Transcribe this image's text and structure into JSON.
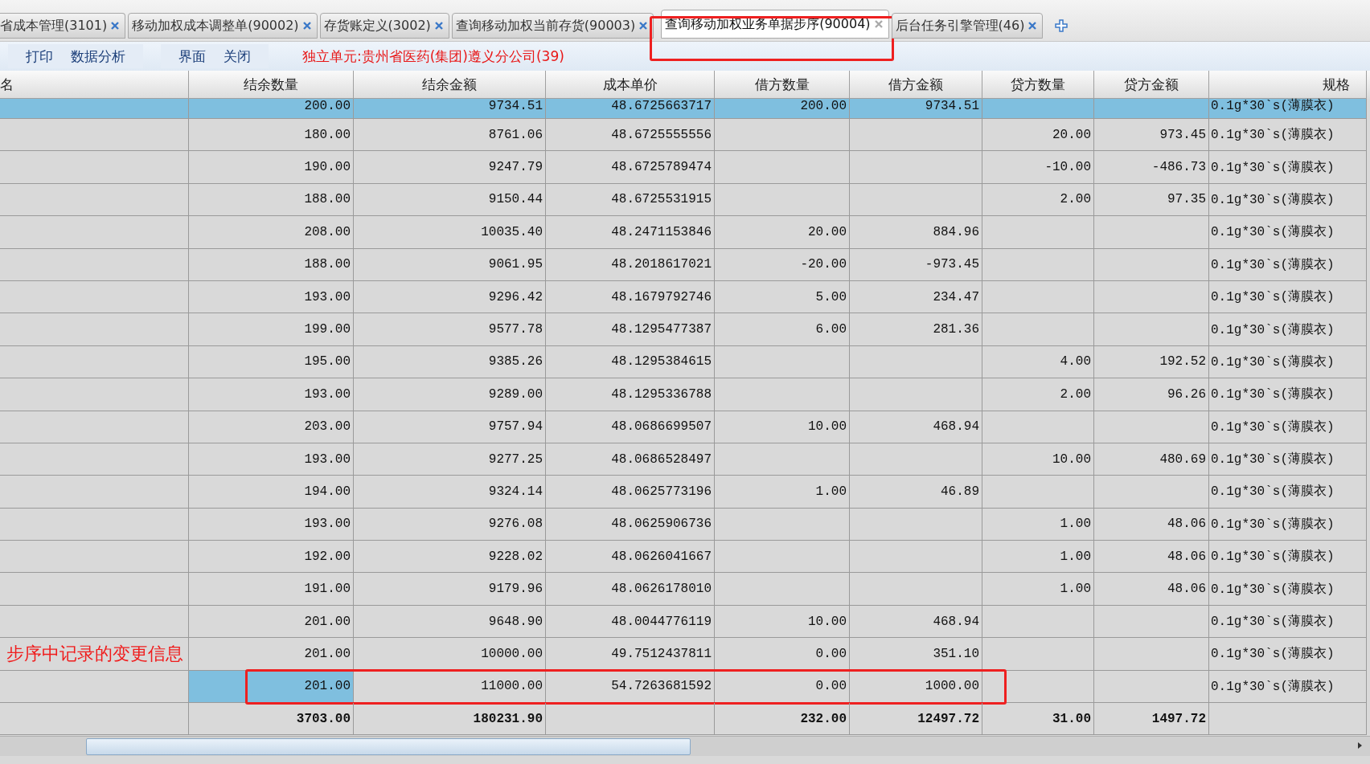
{
  "tabs": [
    {
      "label": "省成本管理(3101)",
      "selected": false,
      "highlighted": false
    },
    {
      "label": "移动加权成本调整单(90002)",
      "selected": false,
      "highlighted": false
    },
    {
      "label": "存货账定义(3002)",
      "selected": false,
      "highlighted": false
    },
    {
      "label": "查询移动加权当前存货(90003)",
      "selected": false,
      "highlighted": false
    },
    {
      "label": "查询移动加权业务单据步序(90004)",
      "selected": true,
      "highlighted": true
    },
    {
      "label": "后台任务引擎管理(46)",
      "selected": false,
      "highlighted": false
    }
  ],
  "toolbar": {
    "groups": [
      [
        "打印",
        "数据分析"
      ],
      [
        "界面",
        "关闭"
      ]
    ],
    "unit_info": "独立单元:贵州省医药(集团)遵义分公司(39)"
  },
  "table": {
    "columns": [
      "名",
      "结余数量",
      "结余金额",
      "成本单价",
      "借方数量",
      "借方金额",
      "贷方数量",
      "贷方金额",
      "规格"
    ],
    "rows": [
      {
        "balance_qty": "200.00",
        "balance_amount": "9734.51",
        "unit_cost": "48.6725663717",
        "debit_qty": "200.00",
        "debit_amount": "9734.51",
        "spec": "0.1g*30`s(薄膜衣)",
        "selected": true,
        "cell_active": false,
        "highlighted": false
      },
      {
        "balance_qty": "180.00",
        "balance_amount": "8761.06",
        "unit_cost": "48.6725555556",
        "credit_qty": "20.00",
        "credit_amount": "973.45",
        "spec": "0.1g*30`s(薄膜衣)",
        "selected": false,
        "cell_active": false,
        "highlighted": false
      },
      {
        "balance_qty": "190.00",
        "balance_amount": "9247.79",
        "unit_cost": "48.6725789474",
        "credit_qty": "-10.00",
        "credit_amount": "-486.73",
        "spec": "0.1g*30`s(薄膜衣)",
        "selected": false,
        "cell_active": false,
        "highlighted": false
      },
      {
        "balance_qty": "188.00",
        "balance_amount": "9150.44",
        "unit_cost": "48.6725531915",
        "credit_qty": "2.00",
        "credit_amount": "97.35",
        "spec": "0.1g*30`s(薄膜衣)",
        "selected": false,
        "cell_active": false,
        "highlighted": false
      },
      {
        "balance_qty": "208.00",
        "balance_amount": "10035.40",
        "unit_cost": "48.2471153846",
        "debit_qty": "20.00",
        "debit_amount": "884.96",
        "spec": "0.1g*30`s(薄膜衣)",
        "selected": false,
        "cell_active": false,
        "highlighted": false
      },
      {
        "balance_qty": "188.00",
        "balance_amount": "9061.95",
        "unit_cost": "48.2018617021",
        "debit_qty": "-20.00",
        "debit_amount": "-973.45",
        "spec": "0.1g*30`s(薄膜衣)",
        "selected": false,
        "cell_active": false,
        "highlighted": false
      },
      {
        "balance_qty": "193.00",
        "balance_amount": "9296.42",
        "unit_cost": "48.1679792746",
        "debit_qty": "5.00",
        "debit_amount": "234.47",
        "spec": "0.1g*30`s(薄膜衣)",
        "selected": false,
        "cell_active": false,
        "highlighted": false
      },
      {
        "balance_qty": "199.00",
        "balance_amount": "9577.78",
        "unit_cost": "48.1295477387",
        "debit_qty": "6.00",
        "debit_amount": "281.36",
        "spec": "0.1g*30`s(薄膜衣)",
        "selected": false,
        "cell_active": false,
        "highlighted": false
      },
      {
        "balance_qty": "195.00",
        "balance_amount": "9385.26",
        "unit_cost": "48.1295384615",
        "credit_qty": "4.00",
        "credit_amount": "192.52",
        "spec": "0.1g*30`s(薄膜衣)",
        "selected": false,
        "cell_active": false,
        "highlighted": false
      },
      {
        "balance_qty": "193.00",
        "balance_amount": "9289.00",
        "unit_cost": "48.1295336788",
        "credit_qty": "2.00",
        "credit_amount": "96.26",
        "spec": "0.1g*30`s(薄膜衣)",
        "selected": false,
        "cell_active": false,
        "highlighted": false
      },
      {
        "balance_qty": "203.00",
        "balance_amount": "9757.94",
        "unit_cost": "48.0686699507",
        "debit_qty": "10.00",
        "debit_amount": "468.94",
        "spec": "0.1g*30`s(薄膜衣)",
        "selected": false,
        "cell_active": false,
        "highlighted": false
      },
      {
        "balance_qty": "193.00",
        "balance_amount": "9277.25",
        "unit_cost": "48.0686528497",
        "credit_qty": "10.00",
        "credit_amount": "480.69",
        "spec": "0.1g*30`s(薄膜衣)",
        "selected": false,
        "cell_active": false,
        "highlighted": false
      },
      {
        "balance_qty": "194.00",
        "balance_amount": "9324.14",
        "unit_cost": "48.0625773196",
        "debit_qty": "1.00",
        "debit_amount": "46.89",
        "spec": "0.1g*30`s(薄膜衣)",
        "selected": false,
        "cell_active": false,
        "highlighted": false
      },
      {
        "balance_qty": "193.00",
        "balance_amount": "9276.08",
        "unit_cost": "48.0625906736",
        "credit_qty": "1.00",
        "credit_amount": "48.06",
        "spec": "0.1g*30`s(薄膜衣)",
        "selected": false,
        "cell_active": false,
        "highlighted": false
      },
      {
        "balance_qty": "192.00",
        "balance_amount": "9228.02",
        "unit_cost": "48.0626041667",
        "credit_qty": "1.00",
        "credit_amount": "48.06",
        "spec": "0.1g*30`s(薄膜衣)",
        "selected": false,
        "cell_active": false,
        "highlighted": false
      },
      {
        "balance_qty": "191.00",
        "balance_amount": "9179.96",
        "unit_cost": "48.0626178010",
        "credit_qty": "1.00",
        "credit_amount": "48.06",
        "spec": "0.1g*30`s(薄膜衣)",
        "selected": false,
        "cell_active": false,
        "highlighted": false
      },
      {
        "balance_qty": "201.00",
        "balance_amount": "9648.90",
        "unit_cost": "48.0044776119",
        "debit_qty": "10.00",
        "debit_amount": "468.94",
        "spec": "0.1g*30`s(薄膜衣)",
        "selected": false,
        "cell_active": false,
        "highlighted": false
      },
      {
        "note": "步序中记录的变更信息",
        "balance_qty": "201.00",
        "balance_amount": "10000.00",
        "unit_cost": "49.7512437811",
        "debit_qty": "0.00",
        "debit_amount": "351.10",
        "spec": "0.1g*30`s(薄膜衣)",
        "selected": false,
        "cell_active": false,
        "highlighted": false
      },
      {
        "balance_qty": "201.00",
        "balance_amount": "11000.00",
        "unit_cost": "54.7263681592",
        "debit_qty": "0.00",
        "debit_amount": "1000.00",
        "spec": "0.1g*30`s(薄膜衣)",
        "selected": false,
        "cell_active": true,
        "highlighted": true
      }
    ],
    "totals": {
      "balance_qty": "3703.00",
      "balance_amount": "180231.90",
      "debit_qty": "232.00",
      "debit_amount": "12497.72",
      "credit_qty": "31.00",
      "credit_amount": "1497.72"
    }
  }
}
